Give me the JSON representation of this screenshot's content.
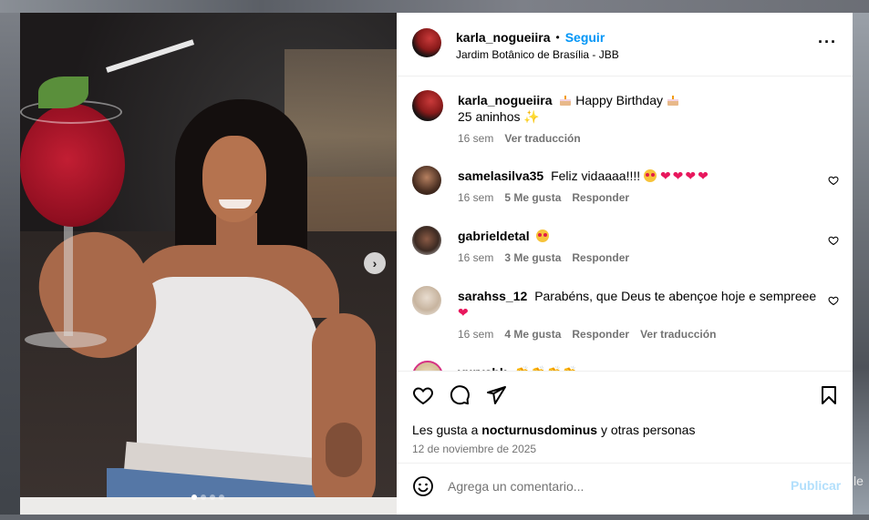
{
  "post": {
    "username": "karla_nogueiira",
    "follow_label": "Seguir",
    "separator": "•",
    "location": "Jardim Botânico de Brasília - JBB",
    "more_icon": "more-options-icon"
  },
  "caption": {
    "username": "karla_nogueiira",
    "line1": "Happy Birthday",
    "line2": "25 aninhos",
    "time": "16 sem",
    "translate": "Ver traducción"
  },
  "comments": [
    {
      "username": "samelasilva35",
      "text": "Feliz vidaaaa!!!!",
      "time": "16 sem",
      "likes": "5 Me gusta",
      "reply": "Responder"
    },
    {
      "username": "gabrieldetal",
      "text": "",
      "time": "16 sem",
      "likes": "3 Me gusta",
      "reply": "Responder"
    },
    {
      "username": "sarahss_12",
      "text": "Parabéns, que Deus te abençoe hoje e sempreee",
      "time": "16 sem",
      "likes": "4 Me gusta",
      "reply": "Responder",
      "translate": "Ver traducción"
    },
    {
      "username": "yurysbk",
      "text": ""
    }
  ],
  "likes_line": {
    "prefix": "Les gusta a",
    "user": "nocturnusdominus",
    "suffix": "y otras personas"
  },
  "date": "12 de noviembre de 2025",
  "composer": {
    "placeholder": "Agrega un comentario...",
    "publish": "Publicar"
  },
  "carousel": {
    "slides": 4,
    "active": 0
  },
  "backdrop_side_text": "le",
  "colors": {
    "link": "#0095f6",
    "publish_disabled": "#b2dffc",
    "muted": "#737373",
    "heart": "#e8175d"
  }
}
